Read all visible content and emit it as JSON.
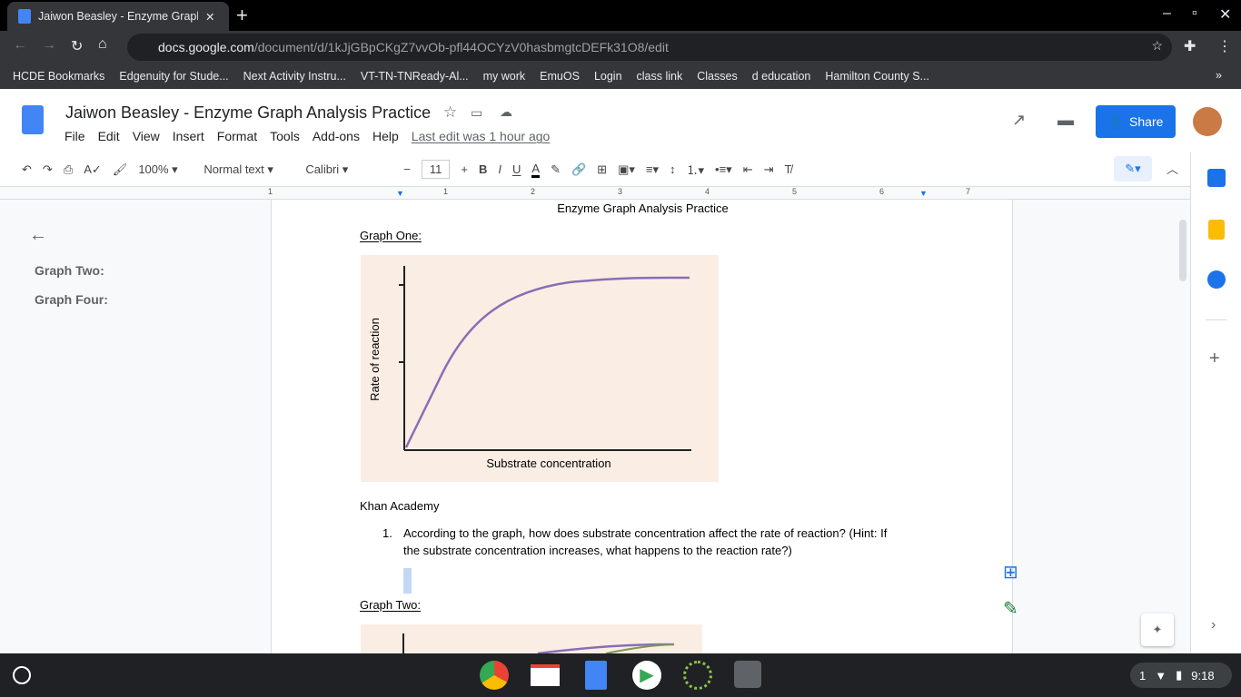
{
  "browser": {
    "tab_title": "Jaiwon Beasley - Enzyme Graph",
    "url_domain": "docs.google.com",
    "url_path": "/document/d/1kJjGBpCKgZ7vvOb-pfl44OCYzV0hasbmgtcDEFk31O8/edit",
    "bookmarks": [
      "HCDE Bookmarks",
      "Edgenuity for Stude...",
      "Next Activity Instru...",
      "VT-TN-TNReady-Al...",
      "my work",
      "EmuOS",
      "Login",
      "class link",
      "Classes",
      "d education",
      "Hamilton County S..."
    ]
  },
  "doc": {
    "title": "Jaiwon Beasley - Enzyme Graph Analysis Practice",
    "menus": [
      "File",
      "Edit",
      "View",
      "Insert",
      "Format",
      "Tools",
      "Add-ons",
      "Help"
    ],
    "last_edit": "Last edit was 1 hour ago",
    "share": "Share"
  },
  "toolbar": {
    "zoom": "100%",
    "style": "Normal text",
    "font": "Calibri",
    "size": "11"
  },
  "ruler": [
    "1",
    "1",
    "2",
    "3",
    "4",
    "5",
    "6",
    "7"
  ],
  "outline": [
    "Graph Two:",
    "Graph Four:"
  ],
  "content": {
    "heading": "Enzyme Graph Analysis Practice",
    "graph1_label": "Graph One:",
    "graph1_ylabel": "Rate of reaction",
    "graph1_xlabel": "Substrate concentration",
    "source": "Khan Academy",
    "q1_num": "1.",
    "q1_line1": "According to the graph, how does substrate concentration affect the rate of reaction? (Hint:  If",
    "q1_line2": "the substrate concentration increases, what happens to the reaction rate?)",
    "graph2_label": "Graph Two:"
  },
  "shelf": {
    "time": "9:18",
    "notif": "1"
  }
}
